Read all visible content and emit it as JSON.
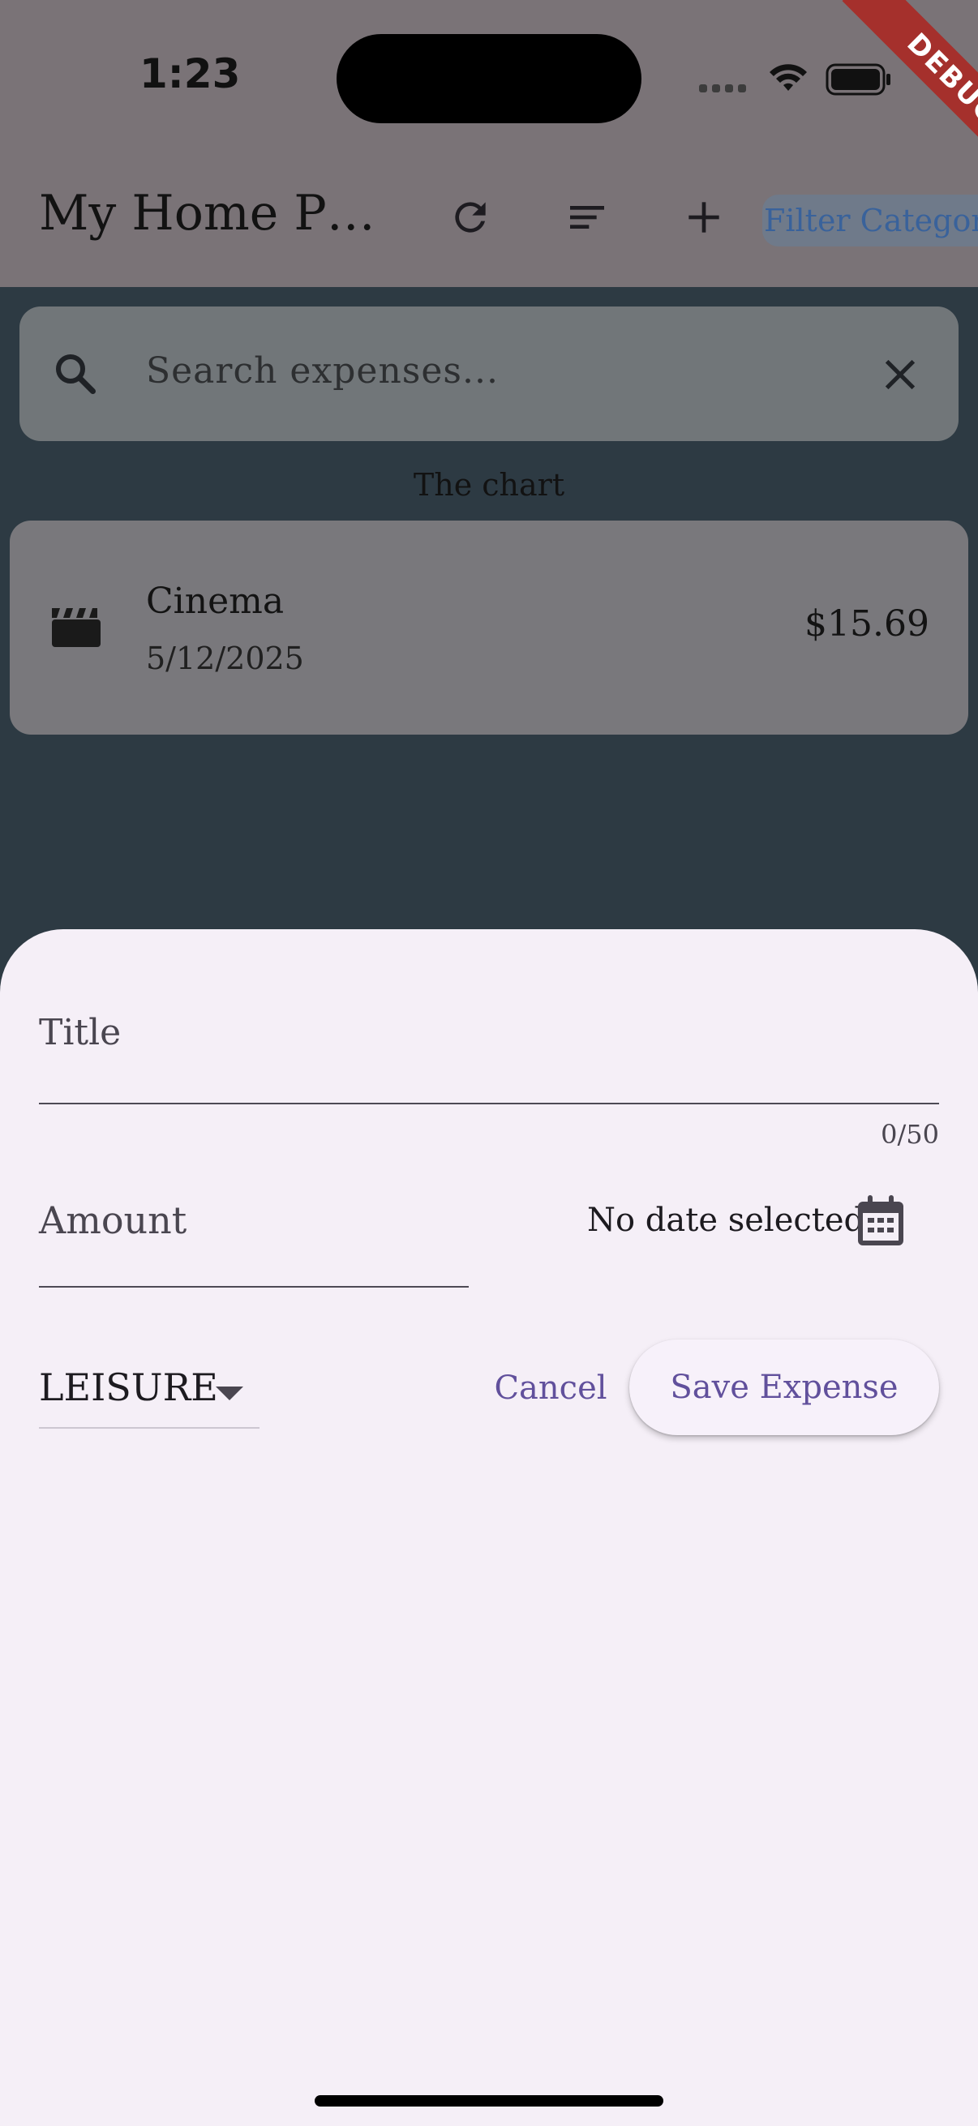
{
  "status_bar": {
    "time": "1:23"
  },
  "debug_banner": {
    "label": "DEBUG"
  },
  "app_bar": {
    "title": "My Home P…",
    "actions": [
      {
        "icon": "refresh-icon"
      },
      {
        "icon": "sort-icon"
      },
      {
        "icon": "add-icon"
      }
    ],
    "filter_label": "Filter Category"
  },
  "search": {
    "placeholder": "Search expenses...",
    "search_icon": "search-icon",
    "clear_icon": "close-icon"
  },
  "chart_placeholder": "The chart",
  "expenses": [
    {
      "icon": "movie-icon",
      "title": "Cinema",
      "date": "5/12/2025",
      "amount": "$15.69"
    }
  ],
  "form": {
    "title_label": "Title",
    "title_counter": "0/50",
    "amount_label": "Amount",
    "date_text": "No date selected",
    "date_icon": "calendar-icon",
    "category_value": "LEISURE",
    "cancel_label": "Cancel",
    "save_label": "Save Expense"
  },
  "colors": {
    "accent": "#61509c",
    "sheet_background": "#f5eff7",
    "debug_ribbon": "#a5302c",
    "backdrop": "#2d3a43"
  }
}
